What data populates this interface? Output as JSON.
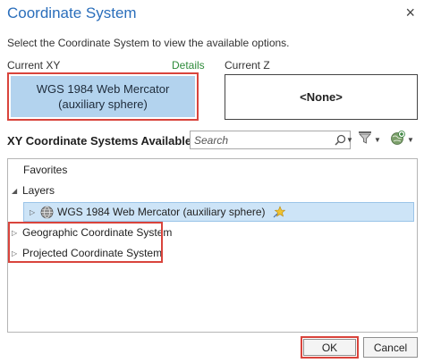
{
  "dialog": {
    "title": "Coordinate System",
    "close_glyph": "×",
    "description": "Select the Coordinate System to view the available options."
  },
  "current_xy": {
    "label": "Current XY",
    "details_link": "Details",
    "value_line1": "WGS 1984 Web Mercator",
    "value_line2": "(auxiliary sphere)"
  },
  "current_z": {
    "label": "Current Z",
    "value": "<None>"
  },
  "systems": {
    "title": "XY Coordinate Systems Available",
    "search_placeholder": "Search",
    "filter_icon": "filter-icon",
    "add_icon": "globe-add-icon"
  },
  "tree": {
    "favorites": "Favorites",
    "layers": "Layers",
    "layer_item": "WGS 1984 Web Mercator (auxiliary sphere)",
    "geographic": "Geographic Coordinate System",
    "projected": "Projected Coordinate System"
  },
  "buttons": {
    "ok": "OK",
    "cancel": "Cancel"
  },
  "colors": {
    "title": "#2a6ebb",
    "details": "#2e8b3a",
    "highlight": "#d9443c",
    "selection": "#b3d3ee"
  }
}
